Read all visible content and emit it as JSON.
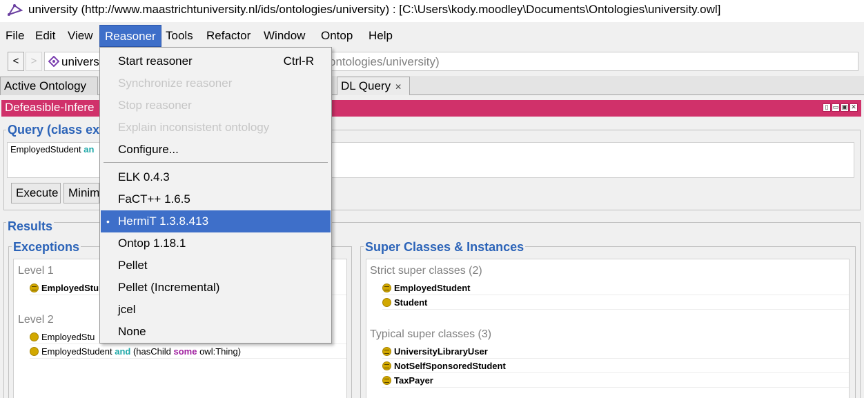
{
  "window": {
    "title": "university (http://www.maastrichtuniversity.nl/ids/ontologies/university)  : [C:\\Users\\kody.moodley\\Documents\\Ontologies\\university.owl]"
  },
  "menubar": {
    "items": [
      "File",
      "Edit",
      "View",
      "Reasoner",
      "Tools",
      "Refactor",
      "Window",
      "Ontop",
      "Help"
    ],
    "active": "Reasoner"
  },
  "toolbar": {
    "back_label": "<",
    "forward_label": ">",
    "ontology_name": "univers",
    "ontology_iri_visible": "ontologies/university)"
  },
  "tabs": [
    {
      "label": "Active Ontology"
    },
    {
      "label": "DL Query",
      "close": "✕"
    }
  ],
  "view": {
    "title": "Defeasible-Infere",
    "win_icons": [
      "▯",
      "▭",
      "▣",
      "✕"
    ]
  },
  "query": {
    "title": "Query (class exp",
    "text_start": "EmployedStudent ",
    "text_and": "an",
    "execute_label": "Execute",
    "minimise_label": "Minim"
  },
  "results": {
    "title": "Results",
    "exceptions": {
      "title": "Exceptions",
      "level1_label": "Level 1",
      "level1_items": [
        "EmployedStu"
      ],
      "level2_label": "Level 2",
      "level2_items": [
        {
          "prefix": "EmployedStu"
        },
        {
          "prefix": "EmployedStudent ",
          "kw1": "and",
          "mid": " (hasChild ",
          "kw2": "some",
          "suffix": " owl:Thing)"
        }
      ]
    },
    "super": {
      "title": "Super Classes & Instances",
      "strict_label": "Strict super classes (2)",
      "strict_items": [
        {
          "label": "EmployedStudent",
          "icon": "equivalent-class-icon"
        },
        {
          "label": "Student",
          "icon": "class-icon"
        }
      ],
      "typical_label": "Typical super classes (3)",
      "typical_items": [
        {
          "label": "UniversityLibraryUser",
          "icon": "equivalent-class-icon"
        },
        {
          "label": "NotSelfSponsoredStudent",
          "icon": "equivalent-class-icon"
        },
        {
          "label": "TaxPayer",
          "icon": "equivalent-class-icon"
        }
      ]
    }
  },
  "reasoner_menu": {
    "items": [
      {
        "label": "Start reasoner",
        "shortcut": "Ctrl-R",
        "enabled": true
      },
      {
        "label": "Synchronize reasoner",
        "enabled": false
      },
      {
        "label": "Stop reasoner",
        "enabled": false
      },
      {
        "label": "Explain inconsistent ontology",
        "enabled": false
      },
      {
        "label": "Configure...",
        "enabled": true
      },
      {
        "label": "ELK 0.4.3",
        "enabled": true
      },
      {
        "label": "FaCT++ 1.6.5",
        "enabled": true
      },
      {
        "label": "HermiT 1.3.8.413",
        "enabled": true,
        "selected": true,
        "bullet": "•"
      },
      {
        "label": "Ontop 1.18.1",
        "enabled": true
      },
      {
        "label": "Pellet",
        "enabled": true
      },
      {
        "label": "Pellet (Incremental)",
        "enabled": true
      },
      {
        "label": "jcel",
        "enabled": true
      },
      {
        "label": "None",
        "enabled": true
      }
    ]
  },
  "colors": {
    "accent_blue": "#3e6fc9",
    "view_header": "#d0316a",
    "panel_title": "#2b63b8",
    "class_icon": "#d2a800",
    "keyword_and": "#1fa8a8",
    "keyword_some": "#a020a0"
  }
}
